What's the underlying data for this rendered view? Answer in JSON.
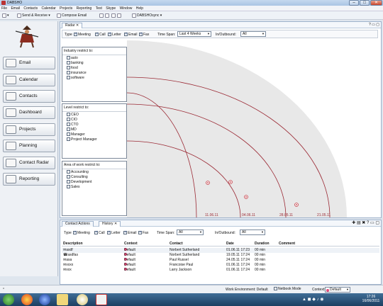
{
  "window": {
    "title": "DABSHO",
    "min": "–",
    "max": "□",
    "close": "✕"
  },
  "menu": [
    "File",
    "Email",
    "Contacts",
    "Calendar",
    "Projects",
    "Reporting",
    "Test",
    "Skype",
    "Window",
    "Help"
  ],
  "toolbar": {
    "send_receive": "Send & Receive",
    "compose": "Compose Email",
    "sync": "DABSHOsync"
  },
  "sidebar": {
    "items": [
      {
        "label": "Email"
      },
      {
        "label": "Calendar"
      },
      {
        "label": "Contacts"
      },
      {
        "label": "Dashboard"
      },
      {
        "label": "Projects"
      },
      {
        "label": "Planning"
      },
      {
        "label": "Contact Radar"
      },
      {
        "label": "Reporting"
      }
    ]
  },
  "radar": {
    "tab": "Radar",
    "type_label": "Type",
    "types": [
      {
        "label": "Meeting",
        "checked": true
      },
      {
        "label": "Call",
        "checked": true
      },
      {
        "label": "Letter",
        "checked": true
      },
      {
        "label": "Email",
        "checked": true
      },
      {
        "label": "Fax",
        "checked": true
      }
    ],
    "timespan_label": "Time Span:",
    "timespan_value": "Last 4 Weeks",
    "inout_label": "In/Outbound:",
    "inout_value": "All",
    "industry_title": "Industry restrict to:",
    "industry": [
      "auto",
      "banking",
      "food",
      "insurance",
      "software"
    ],
    "level_title": "Level restrict to:",
    "level": [
      "CEO",
      "CIO",
      "CTO",
      "MD",
      "Manager",
      "Project Manager"
    ],
    "work_title": "Area of work restrict to:",
    "work": [
      "Accounting",
      "Consulting",
      "Development",
      "Sales"
    ],
    "arc_labels": [
      "11.06.11",
      "04.06.11",
      "28.05.11",
      "21.05.11"
    ]
  },
  "history": {
    "tab1": "Contact Actions",
    "tab2": "History",
    "type_label": "Type",
    "types": [
      {
        "label": "Meeting",
        "checked": true
      },
      {
        "label": "Call",
        "checked": true
      },
      {
        "label": "Letter",
        "checked": true
      },
      {
        "label": "Email",
        "checked": true
      },
      {
        "label": "Fax",
        "checked": true
      }
    ],
    "timespan_label": "Time Span:",
    "timespan_value": "All",
    "inout_label": "In/Outbound:",
    "inout_value": "All",
    "columns": [
      "Description",
      "Context",
      "Contact",
      "Date",
      "Duration",
      "Comment"
    ],
    "rows": [
      {
        "desc": "asdf",
        "context": "Default",
        "contact": "Norbert Sutherland",
        "date": "01.06.11 17:23",
        "duration": "00 min",
        "comment": ""
      },
      {
        "desc": "asdfas",
        "context": "Default",
        "contact": "Norbert Sutherland",
        "date": "19.05.11 17:24",
        "duration": "00 min",
        "comment": ""
      },
      {
        "desc": "asa",
        "context": "Default",
        "contact": "Paul Russel",
        "date": "24.05.11 17:24",
        "duration": "00 min",
        "comment": ""
      },
      {
        "desc": "xxxx",
        "context": "Default",
        "contact": "Francoise Paul",
        "date": "01.06.11 17:24",
        "duration": "00 min",
        "comment": ""
      },
      {
        "desc": "xxx",
        "context": "Default",
        "contact": "Larry Jackson",
        "date": "01.06.11 17:24",
        "duration": "00 min",
        "comment": ""
      }
    ]
  },
  "status": {
    "work_env": "Work Environment: Default",
    "netbook": "Netbook Mode",
    "context_label": "Context:",
    "context_value": "Default"
  },
  "taskbar": {
    "time": "17:26",
    "date": "16/06/2011"
  },
  "colors": {
    "arc": "#9b2a35",
    "dot": "#c0303a",
    "accent": "#e24b7a"
  }
}
